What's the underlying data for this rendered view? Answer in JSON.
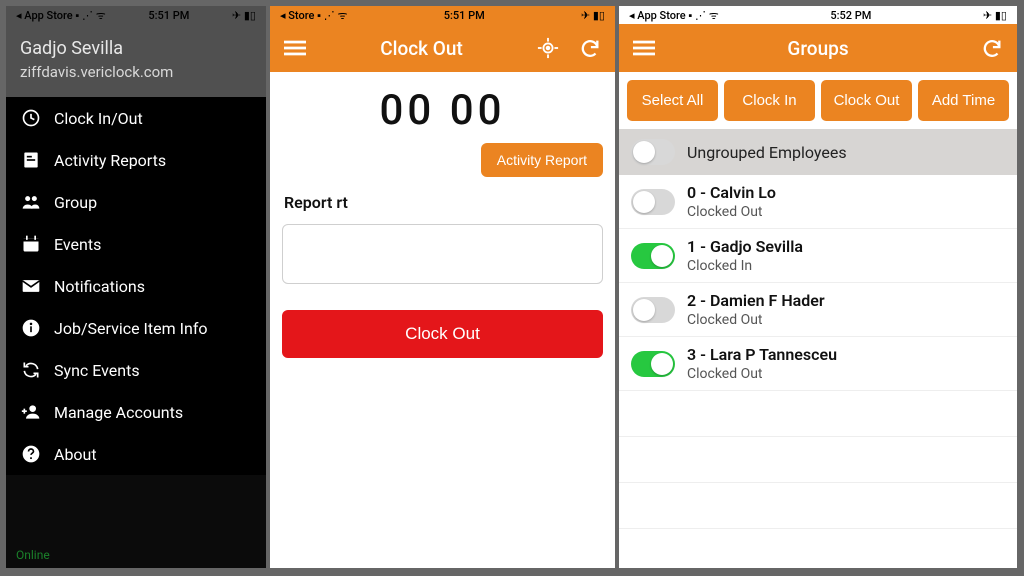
{
  "panel1": {
    "status": {
      "left": "◂ App Store ▪ ⋰ ᯤ",
      "time": "5:51 PM",
      "right": "✈ ▮▯"
    },
    "user": "Gadjo Sevilla",
    "domain": "ziffdavis.vericlock.com",
    "menu": [
      {
        "icon": "clock-icon",
        "label": "Clock In/Out"
      },
      {
        "icon": "report-icon",
        "label": "Activity Reports"
      },
      {
        "icon": "group-icon",
        "label": "Group"
      },
      {
        "icon": "calendar-icon",
        "label": "Events"
      },
      {
        "icon": "envelope-icon",
        "label": "Notifications"
      },
      {
        "icon": "info-icon",
        "label": "Job/Service Item Info"
      },
      {
        "icon": "sync-icon",
        "label": "Sync Events"
      },
      {
        "icon": "manage-icon",
        "label": "Manage Accounts"
      },
      {
        "icon": "question-icon",
        "label": "About"
      }
    ],
    "footer": "Online"
  },
  "panel2": {
    "status": {
      "left": "◂   Store ▪ ⋰ ᯤ",
      "time": "5:51 PM",
      "right": "✈ ▮▯"
    },
    "title": "Clock Out",
    "icons": {
      "left": "menu-icon",
      "loc": "target-icon",
      "refresh": "refresh-icon"
    },
    "time_display": "00   00",
    "activity_btn": "Activity Report",
    "section_label": "Report   rt",
    "clock_out_btn": "Clock Out"
  },
  "panel3": {
    "status": {
      "left": "◂ App Store ▪ ⋰ ᯤ",
      "time": "5:52 PM",
      "right": "✈ ▮▯"
    },
    "title": "Groups",
    "actions": [
      "Select All",
      "Clock In",
      "Clock Out",
      "Add Time"
    ],
    "group_header": "Ungrouped Employees",
    "employees": [
      {
        "name": "0 - Calvin Lo",
        "status": "Clocked Out",
        "on": false
      },
      {
        "name": "1 - Gadjo Sevilla",
        "status": "Clocked In",
        "on": true
      },
      {
        "name": "2 - Damien F Hader",
        "status": "Clocked Out",
        "on": false
      },
      {
        "name": "3 - Lara P Tannesceu",
        "status": "Clocked Out",
        "on": true
      }
    ]
  }
}
